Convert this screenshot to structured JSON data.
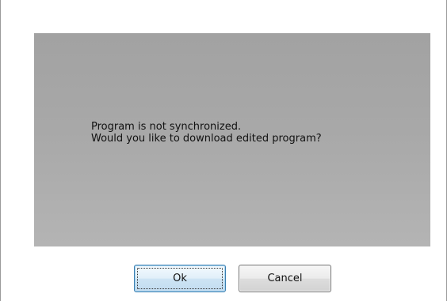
{
  "dialog": {
    "message_line1": "Program is not synchronized.",
    "message_line2": "Would you like to download edited program?"
  },
  "buttons": {
    "ok_label": "Ok",
    "cancel_label": "Cancel"
  },
  "colors": {
    "panel": "#a8a8a8",
    "ok_border": "#3c7fb1",
    "cancel_border": "#707070"
  }
}
